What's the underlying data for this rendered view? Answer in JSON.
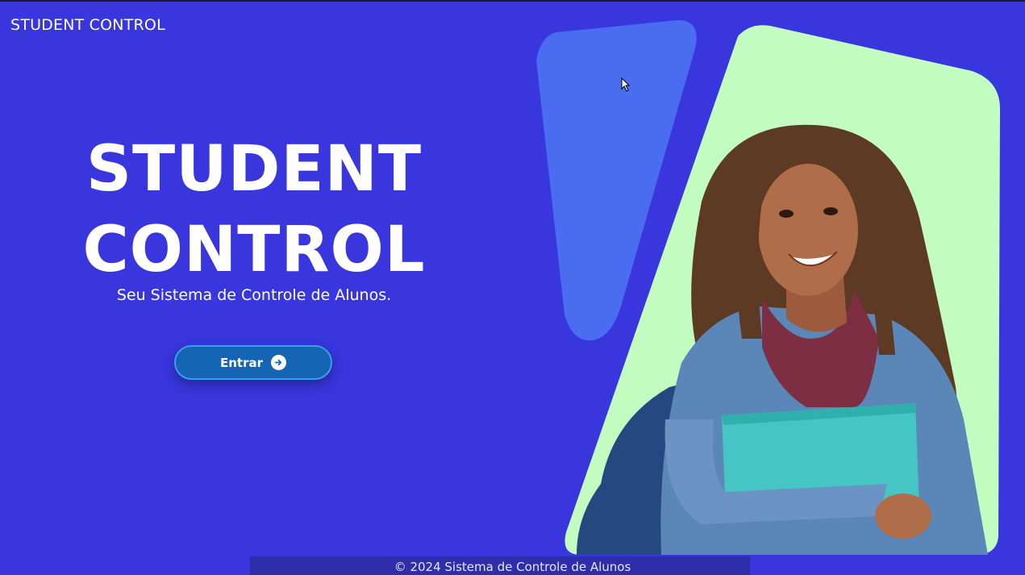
{
  "header": {
    "brand": "STUDENT CONTROL"
  },
  "hero": {
    "title_line1": "STUDENT",
    "title_line2": "CONTROL",
    "subtitle": "Seu Sistema de Controle de Alunos.",
    "enter_label": "Entrar",
    "enter_icon": "arrow-right-circle-icon",
    "image": "student-photo"
  },
  "footer": {
    "copyright": "© 2024 Sistema de Controle de Alunos"
  },
  "colors": {
    "background": "#3836dc",
    "panel_blue": "#4a6cf0",
    "panel_green": "#c3fcc0",
    "button": "#1565b4",
    "button_border": "#3b9ee9"
  }
}
